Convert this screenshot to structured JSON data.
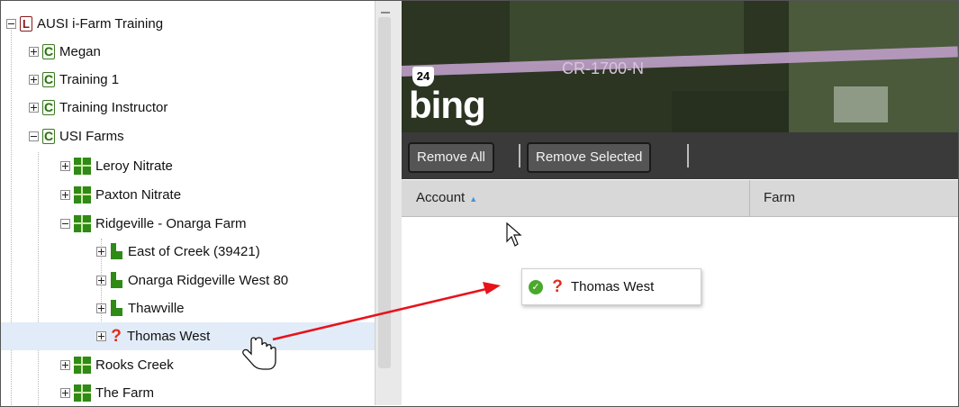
{
  "tree": {
    "nodes": [
      {
        "label": "AUSI i-Farm Training",
        "icon": "L"
      },
      {
        "label": "Megan",
        "icon": "C"
      },
      {
        "label": "Training 1",
        "icon": "C"
      },
      {
        "label": "Training Instructor",
        "icon": "C"
      },
      {
        "label": "USI Farms",
        "icon": "C"
      },
      {
        "label": "Leroy Nitrate",
        "icon": "farm"
      },
      {
        "label": "Paxton Nitrate",
        "icon": "farm"
      },
      {
        "label": "Ridgeville - Onarga Farm",
        "icon": "farm"
      },
      {
        "label": "East of Creek (39421)",
        "icon": "field"
      },
      {
        "label": "Onarga Ridgeville West 80",
        "icon": "field"
      },
      {
        "label": "Thawville",
        "icon": "field"
      },
      {
        "label": "Thomas West",
        "icon": "unknown"
      },
      {
        "label": "Rooks Creek",
        "icon": "farm"
      },
      {
        "label": "The Farm",
        "icon": "farm"
      }
    ]
  },
  "map": {
    "road_label": "CR-1700-N",
    "route_shield": "24",
    "logo": "bing"
  },
  "toolbar": {
    "remove_all": "Remove All",
    "remove_selected": "Remove Selected"
  },
  "grid": {
    "columns": [
      "Account",
      "Farm"
    ],
    "sort_column": "Account",
    "sort_direction": "ascending"
  },
  "drag_tooltip": {
    "label": "Thomas West",
    "status": "ok"
  },
  "colors": {
    "selected_row": "#e2ecf8",
    "toolbar_bg": "#3a3a3a",
    "arrow": "#e8121a",
    "farm_green": "#2f8a16"
  }
}
